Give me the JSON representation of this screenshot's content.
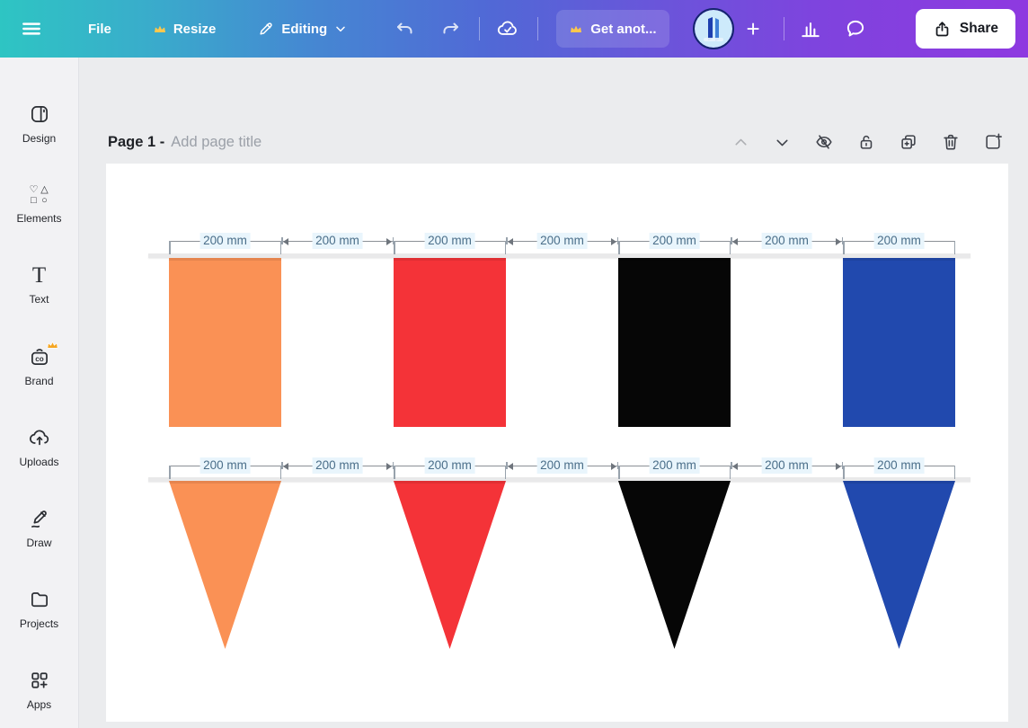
{
  "topbar": {
    "file": "File",
    "resize": "Resize",
    "editing": "Editing",
    "get_another": "Get anot...",
    "share": "Share",
    "colors": {
      "gradient_start": "#2ec5c3",
      "gradient_mid": "#5168d6",
      "gradient_end": "#8e39e0",
      "crown": "#ffc84d",
      "share_bg": "#ffffff",
      "share_text": "#16191f"
    },
    "icons": [
      "hamburger-icon",
      "crown-icon",
      "pencil-icon",
      "chevron-down-icon",
      "undo-icon",
      "redo-icon",
      "cloud-check-icon",
      "plus-icon",
      "bar-chart-icon",
      "chat-icon",
      "share-icon"
    ]
  },
  "sidebar": {
    "items": [
      {
        "id": "design",
        "label": "Design"
      },
      {
        "id": "elements",
        "label": "Elements"
      },
      {
        "id": "text",
        "label": "Text"
      },
      {
        "id": "brand",
        "label": "Brand",
        "pro": true
      },
      {
        "id": "uploads",
        "label": "Uploads"
      },
      {
        "id": "draw",
        "label": "Draw"
      },
      {
        "id": "projects",
        "label": "Projects"
      },
      {
        "id": "apps",
        "label": "Apps"
      }
    ]
  },
  "page_header": {
    "page_label": "Page 1 -",
    "title_placeholder": "Add page title",
    "action_icons": [
      "chevron-up-icon",
      "chevron-down-icon",
      "hide-eye-icon",
      "lock-icon",
      "duplicate-icon",
      "trash-icon",
      "add-page-icon"
    ]
  },
  "canvas": {
    "measurement_value": "200 mm",
    "measurement_text_color": "#4a6e89",
    "measurement_bg": "#e9f5fc",
    "flag_colors": [
      "#FA9155",
      "#F43338",
      "#060606",
      "#2149AE"
    ],
    "rows": [
      {
        "shape": "rect",
        "measurements": [
          "200 mm",
          "200 mm",
          "200 mm",
          "200 mm",
          "200 mm",
          "200 mm",
          "200 mm"
        ]
      },
      {
        "shape": "pennant",
        "measurements": [
          "200 mm",
          "200 mm",
          "200 mm",
          "200 mm",
          "200 mm",
          "200 mm",
          "200 mm"
        ]
      }
    ]
  }
}
